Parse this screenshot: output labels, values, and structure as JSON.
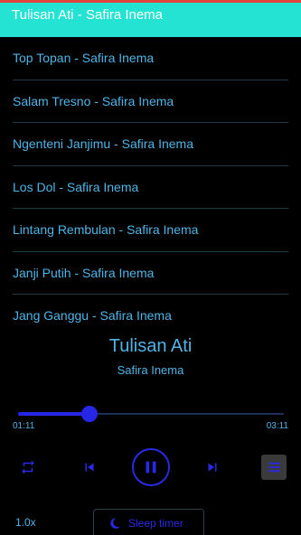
{
  "header": {
    "title": "Tulisan Ati - Safira Inema"
  },
  "playlist": [
    {
      "label": "Top Topan - Safira Inema"
    },
    {
      "label": "Salam Tresno - Safira Inema"
    },
    {
      "label": "Ngenteni Janjimu - Safira Inema"
    },
    {
      "label": "Los Dol - Safira Inema"
    },
    {
      "label": "Lintang Rembulan - Safira Inema"
    },
    {
      "label": "Janji Putih - Safira Inema"
    },
    {
      "label": "Jang Ganggu - Safira Inema"
    }
  ],
  "now_playing": {
    "title": "Tulisan Ati",
    "artist": "Safira Inema"
  },
  "player": {
    "current_time": "01:11",
    "duration": "03:11",
    "progress": 0.27,
    "speed": "1.0x",
    "sleep_timer_label": "Sleep timer",
    "state": "playing"
  },
  "icons": {
    "repeat": "repeat-icon",
    "previous": "skip-previous-icon",
    "pause": "pause-icon",
    "next": "skip-next-icon",
    "queue": "queue-list-icon",
    "sleep": "moon-icon"
  },
  "colors": {
    "header_bg": "#24e3d3",
    "accent": "#2a2ae6",
    "text": "#4fb4e6",
    "background": "#000000"
  }
}
